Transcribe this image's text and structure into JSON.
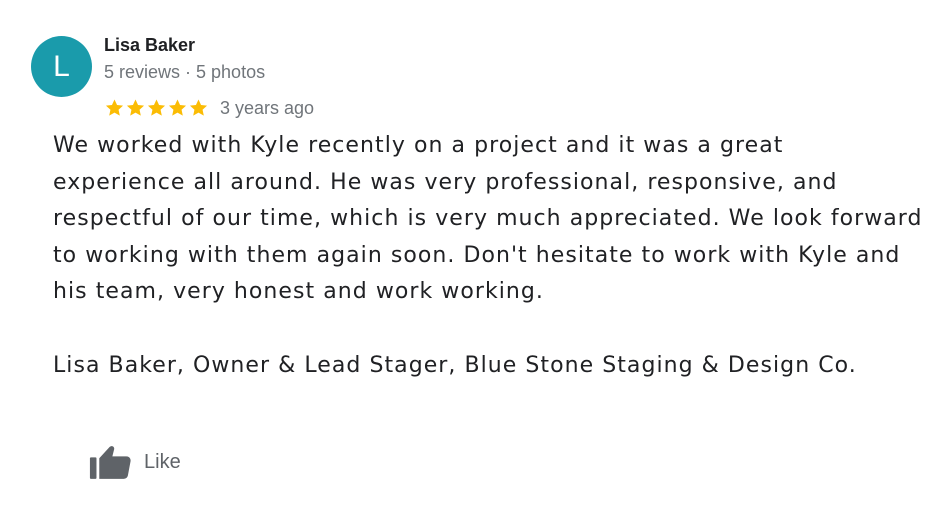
{
  "review": {
    "author": {
      "initial": "L",
      "name": "Lisa Baker",
      "meta": "5 reviews · 5 photos",
      "avatar_color": "#1a9bab"
    },
    "rating": {
      "stars": 5,
      "max_stars": 5,
      "star_color": "#fbbc04",
      "date": "3 years ago"
    },
    "body": {
      "paragraph_1": "We worked with Kyle recently on a project and it was a great experience all around. He was very professional, responsive, and respectful of our time, which is very much appreciated. We look forward to working with them again soon. Don't hesitate to work with Kyle and his team, very honest and work working.",
      "paragraph_2": "Lisa Baker, Owner & Lead Stager, Blue Stone Staging & Design Co."
    },
    "actions": {
      "like_label": "Like",
      "like_icon": "thumbs-up-icon"
    }
  }
}
